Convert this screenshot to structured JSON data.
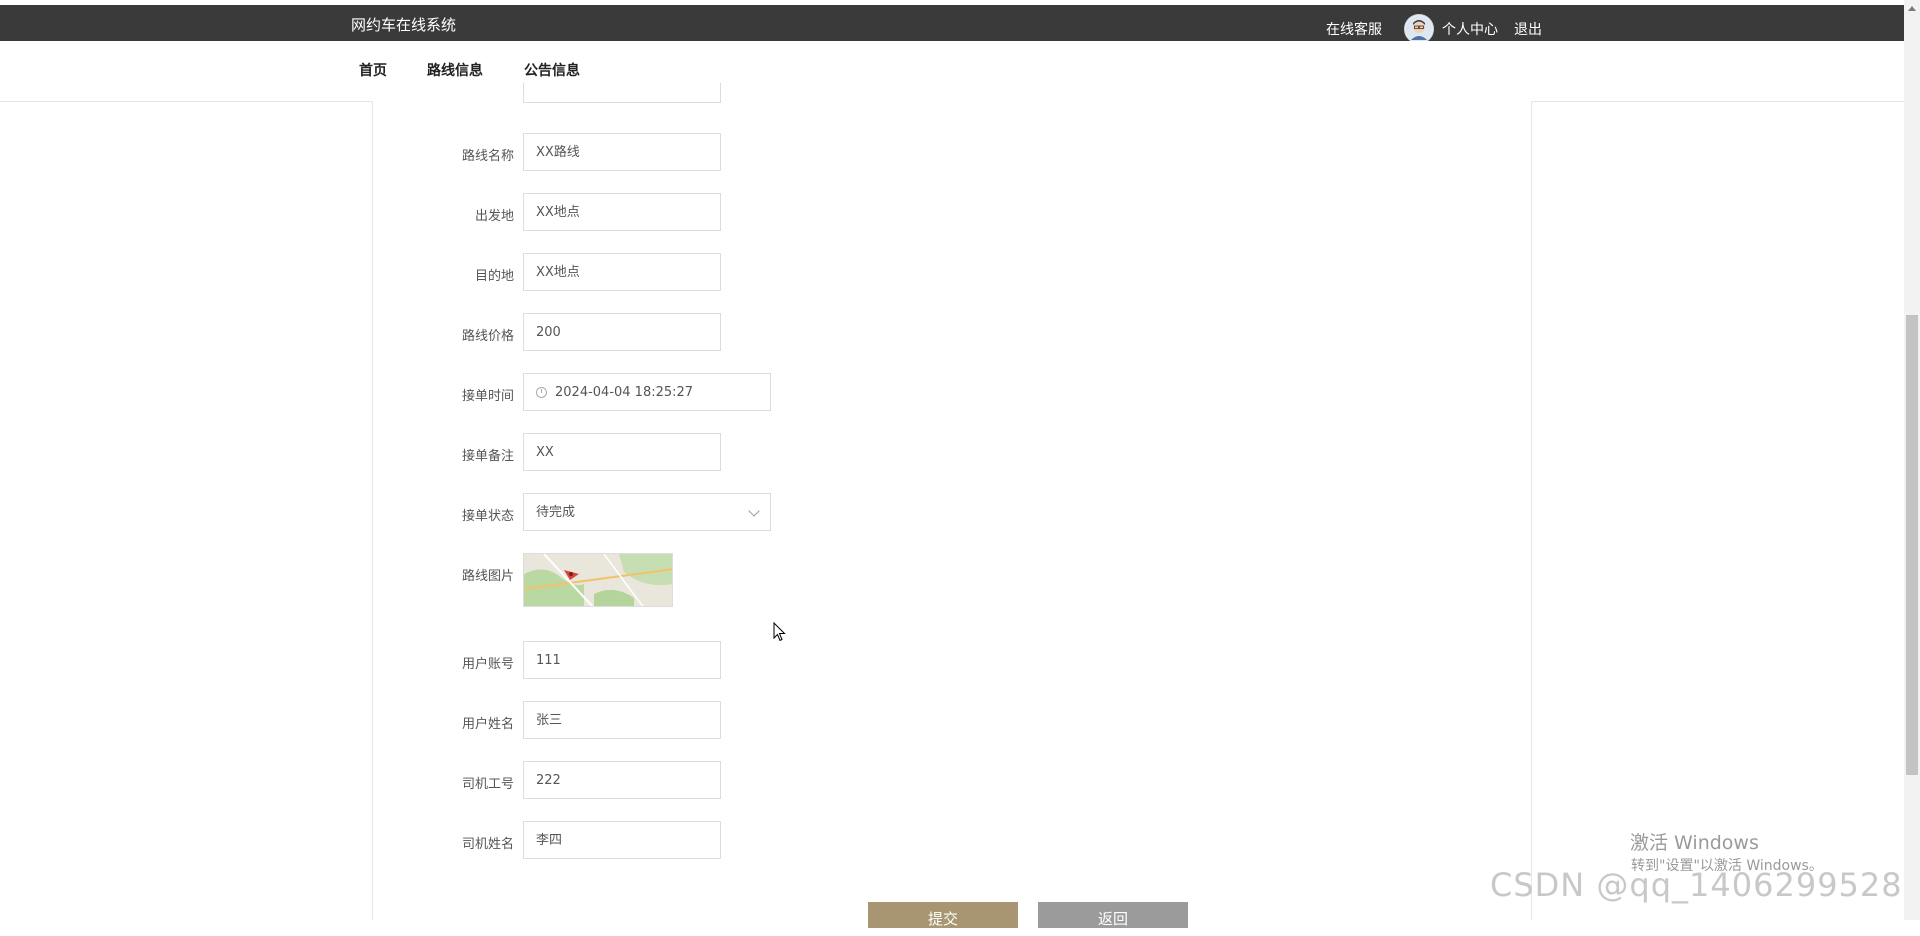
{
  "topbar": {
    "brand": "网约车在线系统",
    "support": "在线客服",
    "user_center": "个人中心",
    "logout": "退出"
  },
  "nav": {
    "items": [
      "首页",
      "路线信息",
      "公告信息"
    ]
  },
  "form": {
    "route_name": {
      "label": "路线名称",
      "value": "XX路线"
    },
    "origin": {
      "label": "出发地",
      "value": "XX地点"
    },
    "destination": {
      "label": "目的地",
      "value": "XX地点"
    },
    "price": {
      "label": "路线价格",
      "value": "200"
    },
    "order_time": {
      "label": "接单时间",
      "value": "2024-04-04 18:25:27"
    },
    "order_note": {
      "label": "接单备注",
      "value": "XX"
    },
    "order_status": {
      "label": "接单状态",
      "value": "待完成"
    },
    "route_image": {
      "label": "路线图片"
    },
    "user_account": {
      "label": "用户账号",
      "value": "111"
    },
    "user_name": {
      "label": "用户姓名",
      "value": "张三"
    },
    "driver_id": {
      "label": "司机工号",
      "value": "222"
    },
    "driver_name": {
      "label": "司机姓名",
      "value": "李四"
    }
  },
  "buttons": {
    "submit": "提交",
    "back": "返回"
  },
  "overlay": {
    "activate_title": "激活 Windows",
    "activate_hint": "转到\"设置\"以激活 Windows。",
    "csdn": "CSDN @qq_1406299528"
  }
}
